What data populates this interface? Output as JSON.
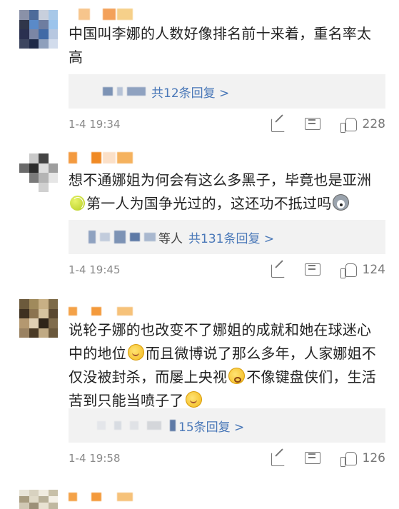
{
  "colors": {
    "link": "#4a78b8",
    "reply_bg": "#f2f2f2",
    "text": "#222222",
    "meta": "#8a8a8a"
  },
  "comments": [
    {
      "avatar_colors": [
        "#8a91a8",
        "#4d6b9a",
        "#c8cfdc",
        "#a8c8e8",
        "#30364a",
        "#5a8ac8",
        "#6e7da0",
        "#9cc4ec",
        "#2a3050",
        "#7b86a5",
        "#416aa6",
        "#b7c7e0",
        "#3d4660",
        "#1e2a48",
        "#8fa0bc",
        "#d2dcec"
      ],
      "name_colors": [
        "#ffffff",
        "#f7c58c",
        "#ffffff",
        "#f3a15a",
        "#f6d08a"
      ],
      "text_lines": [
        "中国叫李娜的人数好像排名前十来着，重名率太",
        "高"
      ],
      "reply": {
        "extra": "",
        "link": "共12条回复 >"
      },
      "time": "1-4 19:34",
      "likes": "228",
      "icons": [
        "share-icon",
        "comment-icon",
        "like-icon"
      ]
    },
    {
      "avatar_colors": [
        "#ffffff",
        "#c9c9c9",
        "#444444",
        "#ffffff",
        "#6a6a6a",
        "#2b2b2b",
        "#dedede",
        "#9e9e9e",
        "#ffffff",
        "#7a7a7a",
        "#b4b4b4",
        "#e6e6e6",
        "#ffffff",
        "#ffffff",
        "#d0d0d0",
        "#ffffff"
      ],
      "name_colors": [
        "#f39a40",
        "#ffffff",
        "#f08a25",
        "#fbe0c8",
        "#f5b25e"
      ],
      "text_before_emoji_1": "想不通娜姐为何会有这么多黑子，毕竟也是亚洲",
      "emoji_1": "tennis-ball",
      "text_line_2": "第一人为国争光过的，这还功不抵过吗",
      "emoji_2": "husky",
      "reply": {
        "extra": "等人",
        "link": "共131条回复 >"
      },
      "time": "1-4 19:45",
      "likes": "124",
      "icons": [
        "share-icon",
        "comment-icon",
        "like-icon"
      ]
    },
    {
      "avatar_colors": [
        "#6c5a3c",
        "#a08a5c",
        "#c8b085",
        "#7d6a48",
        "#3e3020",
        "#8c7450",
        "#d6c4a0",
        "#5a4830",
        "#b49870",
        "#e0d0b4",
        "#2e2418",
        "#806c4c",
        "#9a8262",
        "#4a3a26",
        "#c0aa84",
        "#6a583c"
      ],
      "name_colors": [
        "#f4a248",
        "#ffffff",
        "#f49a3c",
        "#ffffff",
        "#f6c27a"
      ],
      "text_line_1": "说轮子娜的也改变不了娜姐的成就和她在球迷心",
      "text_line_2a": "中的地位",
      "emoji_1": "smile",
      "text_line_2b": "而且微博说了那么多年，人家娜姐不",
      "text_line_3a": "仅没被封杀，而屡上央视",
      "emoji_2": "worried",
      "text_line_3b": "不像键盘侠们，生活",
      "text_line_4": "苦到只能当喷子了",
      "emoji_3": "smile",
      "reply": {
        "extra": "",
        "link": "15条回复 >"
      },
      "time": "1-4 19:58",
      "likes": "126",
      "icons": [
        "share-icon",
        "comment-icon",
        "like-icon"
      ]
    },
    {
      "avatar_colors": [
        "#e8e4d8",
        "#d8d2c0",
        "#f0ece0",
        "#c8c0a8",
        "#a89c80",
        "#e0dac8",
        "#b8b098",
        "#f4f0e6",
        "#d0c8b4",
        "#9c9078",
        "#e8e2d2",
        "#c0b8a0"
      ],
      "name_colors": [
        "#f4a248",
        "#ffffff",
        "#f49a3c",
        "#ffffff",
        "#f6c27a"
      ]
    }
  ]
}
